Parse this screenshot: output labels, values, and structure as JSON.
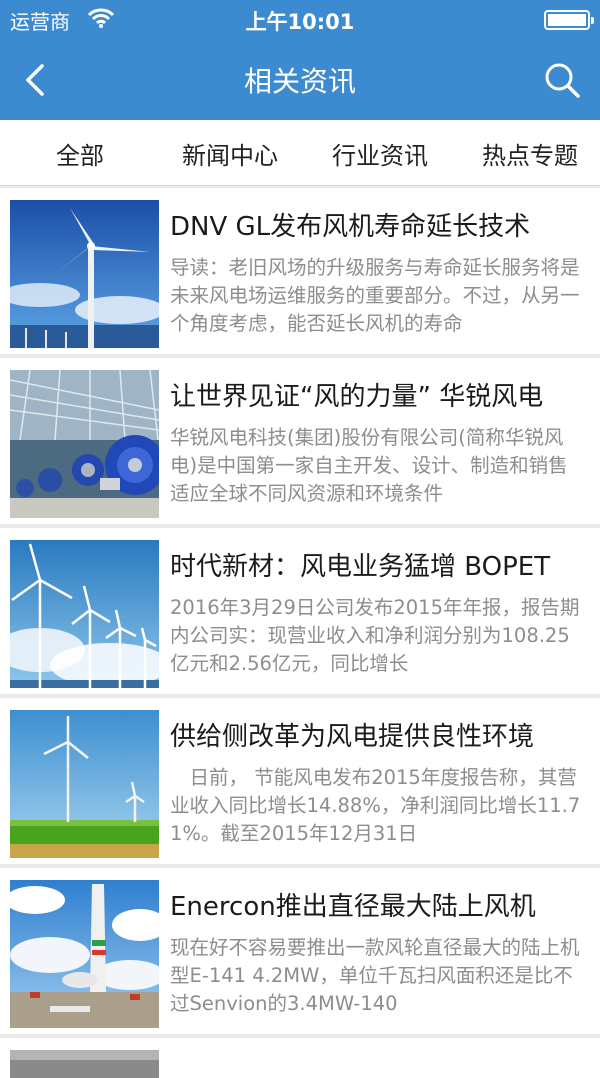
{
  "status_bar": {
    "carrier": "运营商",
    "time": "上午10:01"
  },
  "nav": {
    "title": "相关资讯"
  },
  "tabs": [
    {
      "label": "全部"
    },
    {
      "label": "新闻中心"
    },
    {
      "label": "行业资讯"
    },
    {
      "label": "热点专题"
    }
  ],
  "articles": [
    {
      "title": "DNV GL发布风机寿命延长技术",
      "desc": "导读：老旧风场的升级服务与寿命延长服务将是未来风电场运维服务的重要部分。不过，从另一个角度考虑，能否延长风机的寿命",
      "thumb": "wind-turbine-sky"
    },
    {
      "title": "让世界见证“风的力量” 华锐风电",
      "desc": "华锐风电科技(集团)股份有限公司(简称华锐风电)是中国第一家自主开发、设计、制造和销售适应全球不同风资源和环境条件",
      "thumb": "factory-gearboxes"
    },
    {
      "title": "时代新材：风电业务猛增 BOPET",
      "desc": "2016年3月29日公司发布2015年年报，报告期内公司实：现营业收入和净利润分别为108.25亿元和2.56亿元，同比增长",
      "thumb": "wind-farm-clouds"
    },
    {
      "title": "供给侧改革为风电提供良性环境",
      "desc": "　日前， 节能风电发布2015年度报告称，其营业收入同比增长14.88%，净利润同比增长11.71%。截至2015年12月31日",
      "thumb": "turbines-grassland"
    },
    {
      "title": "Enercon推出直径最大陆上风机",
      "desc": "现在好不容易要推出一款风轮直径最大的陆上机型E-141 4.2MW，单位千瓦扫风面积还是比不过Senvion的3.4MW-140",
      "thumb": "tower-construction"
    }
  ]
}
